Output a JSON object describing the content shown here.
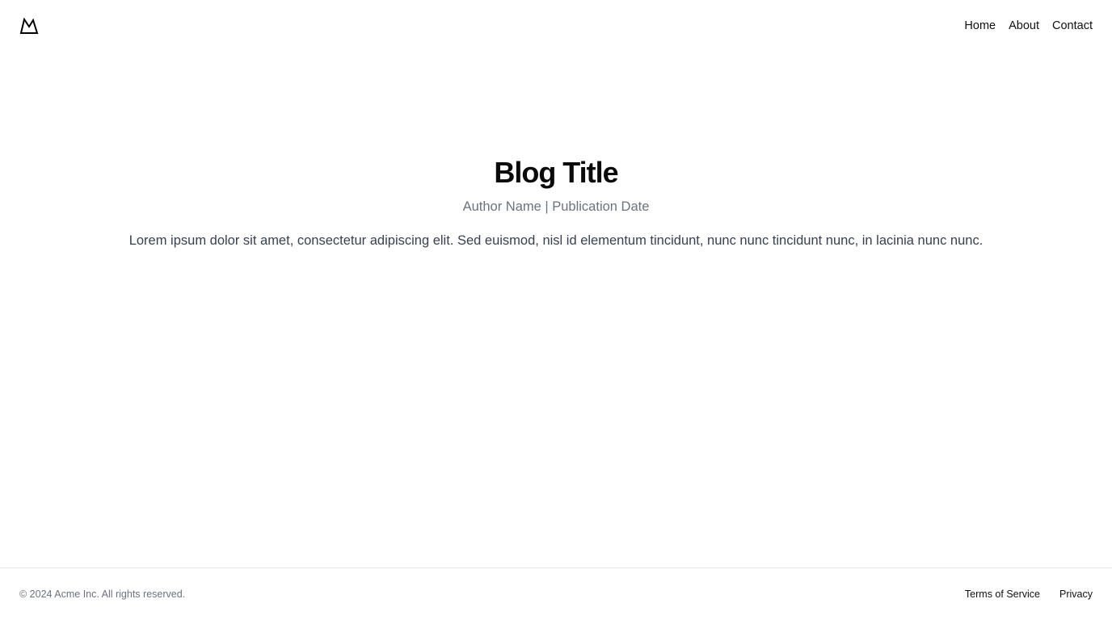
{
  "header": {
    "logo_icon": "mountain-icon",
    "nav": [
      {
        "label": "Home"
      },
      {
        "label": "About"
      },
      {
        "label": "Contact"
      }
    ]
  },
  "article": {
    "title": "Blog Title",
    "meta": "Author Name | Publication Date",
    "body": "Lorem ipsum dolor sit amet, consectetur adipiscing elit. Sed euismod, nisl id elementum tincidunt, nunc nunc tincidunt nunc, in lacinia nunc nunc."
  },
  "footer": {
    "copyright": "© 2024 Acme Inc. All rights reserved.",
    "links": [
      {
        "label": "Terms of Service"
      },
      {
        "label": "Privacy"
      }
    ]
  },
  "colors": {
    "text": "#111111",
    "muted": "#6b7280",
    "body": "#374151",
    "border": "#e5e7eb",
    "background": "#ffffff"
  }
}
